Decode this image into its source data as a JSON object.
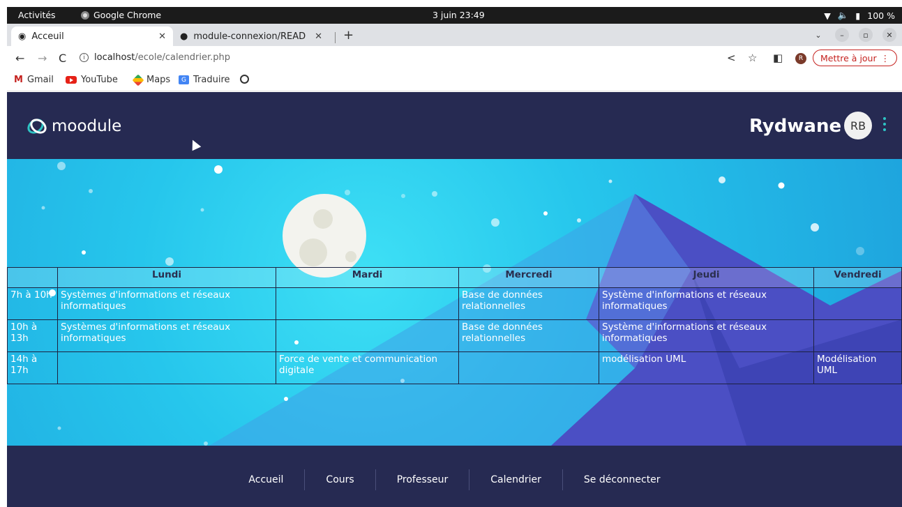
{
  "os": {
    "activities": "Activités",
    "app_name": "Google Chrome",
    "clock": "3 juin 23:49",
    "battery": "100 %"
  },
  "browser": {
    "tabs": [
      {
        "label": "Acceuil"
      },
      {
        "label": "module-connexion/READ"
      }
    ],
    "url_host": "localhost",
    "url_path": "/ecole/calendrier.php",
    "update_label": "Mettre à jour"
  },
  "bookmarks": [
    {
      "label": "Gmail"
    },
    {
      "label": "YouTube"
    },
    {
      "label": "Maps"
    },
    {
      "label": "Traduire"
    }
  ],
  "site": {
    "logo_text": "moodule",
    "username": "Rydwane",
    "avatar_initials": "RB"
  },
  "schedule": {
    "headers": [
      "",
      "Lundi",
      "Mardi",
      "Mercredi",
      "Jeudi",
      "Vendredi"
    ],
    "rows": [
      {
        "time": "7h à 10h",
        "cells": [
          "Systèmes d'informations et réseaux informatiques",
          "",
          "Base de données relationnelles",
          "Système d'informations et réseaux informatiques",
          ""
        ]
      },
      {
        "time": "10h à 13h",
        "cells": [
          "Systèmes d'informations et réseaux informatiques",
          "",
          "Base de données relationnelles",
          "Système d'informations et réseaux informatiques",
          ""
        ]
      },
      {
        "time": "14h à 17h",
        "cells": [
          "",
          "Force de vente et communication digitale",
          "",
          "modélisation UML",
          "Modélisation UML"
        ]
      }
    ]
  },
  "footer": {
    "links": [
      "Accueil",
      "Cours",
      "Professeur",
      "Calendrier",
      "Se déconnecter"
    ]
  },
  "colors": {
    "header_bg": "#262a52",
    "hero_bg": "#26c6ec",
    "mountain": "#4b4fc4",
    "accent": "#2ec4c4"
  }
}
